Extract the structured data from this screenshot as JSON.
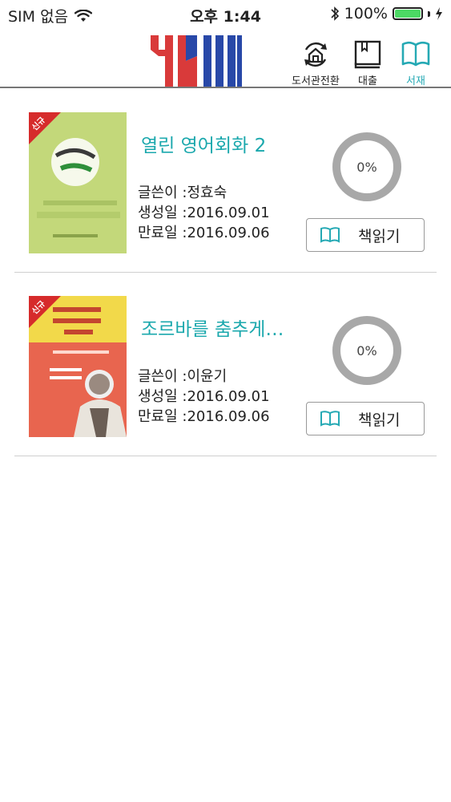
{
  "status_bar": {
    "carrier": "SIM 없음",
    "time": "오후 1:44",
    "battery": "100%",
    "battery_level": 1.0
  },
  "header": {
    "logo_text": "YBM",
    "buttons": [
      {
        "label": "도서관전환",
        "icon": "library-switch-icon"
      },
      {
        "label": "대출",
        "icon": "book-icon"
      },
      {
        "label": "서재",
        "icon": "open-book-icon",
        "active": true
      }
    ]
  },
  "books": [
    {
      "badge": "신규",
      "title": "열린 영어회화 2",
      "author_label": "글쓴이 : ",
      "author": "정효숙",
      "created_label": "생성일 : ",
      "created": "2016.09.01",
      "expires_label": "만료일 : ",
      "expires": "2016.09.06",
      "progress": 0,
      "progress_text": "0%",
      "read_label": "책읽기"
    },
    {
      "badge": "신규",
      "title": "조르바를 춤추게…",
      "author_label": "글쓴이 : ",
      "author": "이윤기",
      "created_label": "생성일 : ",
      "created": "2016.09.01",
      "expires_label": "만료일 : ",
      "expires": "2016.09.06",
      "progress": 0,
      "progress_text": "0%",
      "read_label": "책읽기"
    }
  ],
  "colors": {
    "accent": "#25a9b4",
    "title": "#1ba8ad",
    "badge": "#d62b2b",
    "ring": "#a8a8a8",
    "logo_red": "#d93a3a",
    "logo_blue": "#2848a8"
  }
}
